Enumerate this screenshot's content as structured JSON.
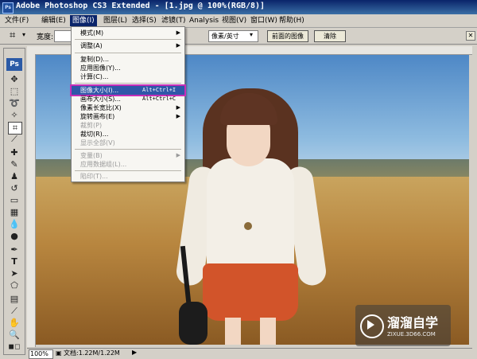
{
  "window": {
    "title": "Adobe Photoshop CS3 Extended - [1.jpg @ 100%(RGB/8)]",
    "app_icon": "Ps"
  },
  "menubar": {
    "items": [
      "文件(F)",
      "编辑(E)",
      "图像(I)",
      "图层(L)",
      "选择(S)",
      "滤镜(T)",
      "Analysis",
      "视图(V)",
      "窗口(W)",
      "帮助(H)"
    ]
  },
  "options": {
    "width_label": "宽度:",
    "unit_select": "像素/英寸",
    "front_image_button": "前面的图像",
    "clear_button": "清除"
  },
  "toolbox": {
    "logo": "Ps"
  },
  "image_menu": {
    "items": [
      {
        "label": "模式(M)",
        "shortcut": "",
        "submenu": true,
        "disabled": false
      },
      {
        "label": "调整(A)",
        "shortcut": "",
        "submenu": true,
        "disabled": false
      },
      {
        "label": "复制(D)...",
        "shortcut": "",
        "submenu": false,
        "disabled": false
      },
      {
        "label": "应用图像(Y)...",
        "shortcut": "",
        "submenu": false,
        "disabled": false
      },
      {
        "label": "计算(C)...",
        "shortcut": "",
        "submenu": false,
        "disabled": false
      },
      {
        "label": "图像大小(I)...",
        "shortcut": "Alt+Ctrl+I",
        "submenu": false,
        "disabled": false,
        "highlighted": true
      },
      {
        "label": "画布大小(S)...",
        "shortcut": "Alt+Ctrl+C",
        "submenu": false,
        "disabled": false
      },
      {
        "label": "像素长宽比(X)",
        "shortcut": "",
        "submenu": true,
        "disabled": false
      },
      {
        "label": "旋转画布(E)",
        "shortcut": "",
        "submenu": true,
        "disabled": false
      },
      {
        "label": "裁剪(P)",
        "shortcut": "",
        "submenu": false,
        "disabled": true
      },
      {
        "label": "裁切(R)...",
        "shortcut": "",
        "submenu": false,
        "disabled": false
      },
      {
        "label": "显示全部(V)",
        "shortcut": "",
        "submenu": false,
        "disabled": true
      },
      {
        "label": "变量(B)",
        "shortcut": "",
        "submenu": true,
        "disabled": true
      },
      {
        "label": "应用数据组(L)...",
        "shortcut": "",
        "submenu": false,
        "disabled": true
      },
      {
        "label": "陷印(T)...",
        "shortcut": "",
        "submenu": false,
        "disabled": true
      }
    ]
  },
  "statusbar": {
    "zoom": "100%",
    "doc_info": "文档:1.22M/1.22M"
  },
  "watermark": {
    "name": "溜溜自学",
    "url": "ZIXUE.3D66.COM"
  },
  "colors": {
    "title_bar": "#0a246a",
    "menu_highlight": "#2f57a8",
    "highlight_outline": "#c52fb8"
  }
}
